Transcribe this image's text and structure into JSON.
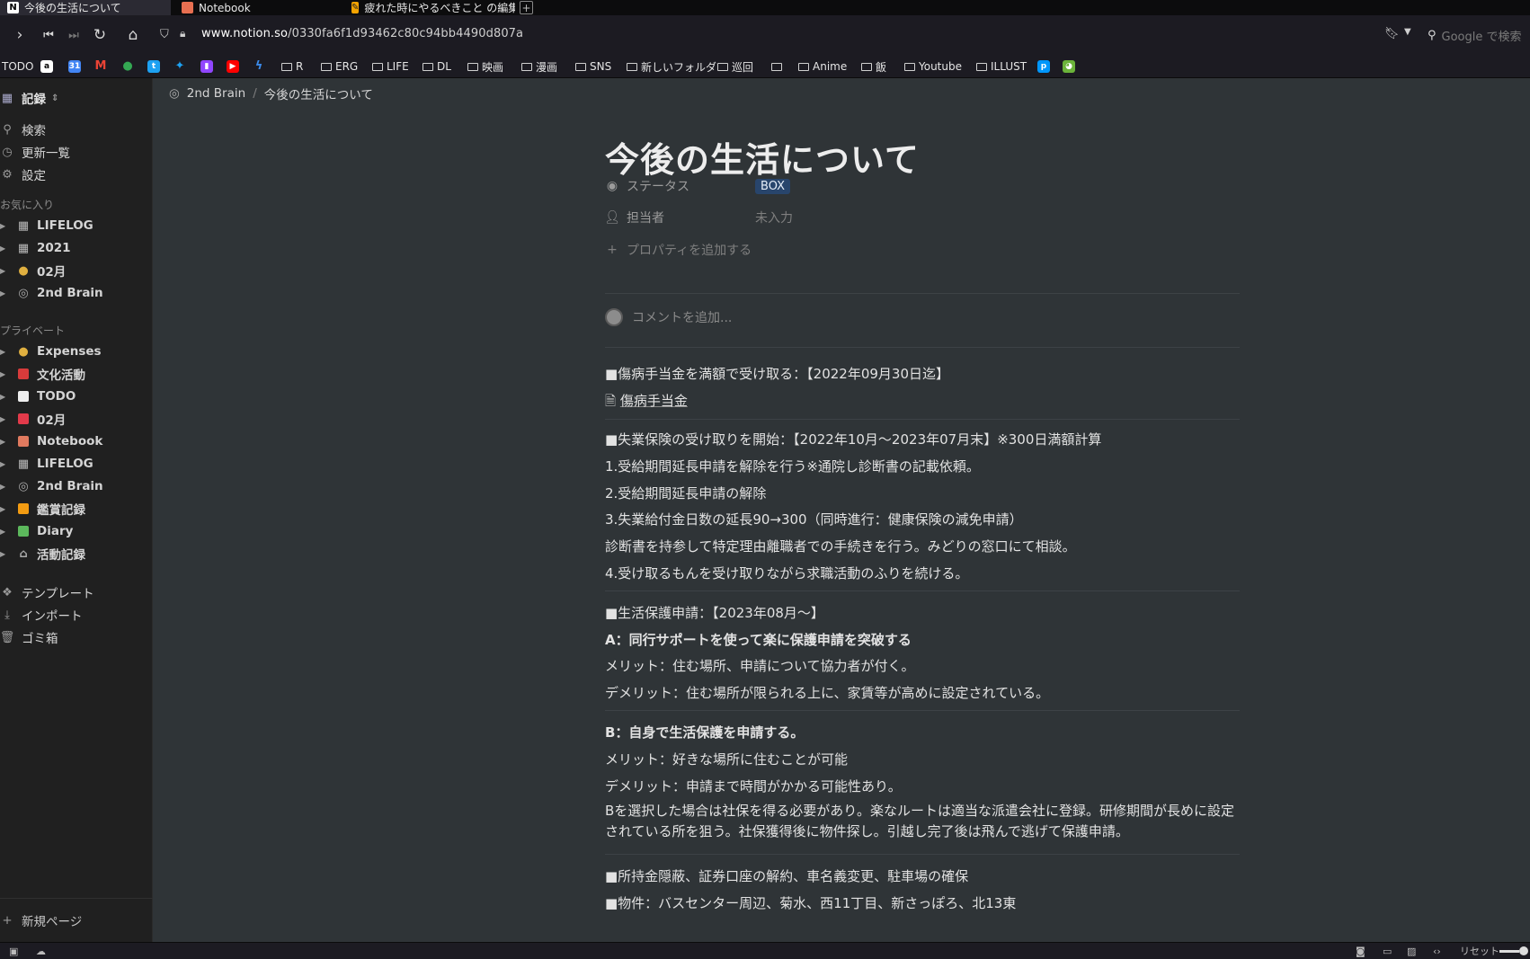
{
  "browser": {
    "tabs": [
      {
        "label": "今後の生活について",
        "icon": "N",
        "active": true
      },
      {
        "label": "Notebook",
        "icon": "notebook",
        "active": false
      },
      {
        "label": "疲れた時にやるべきこと の編集",
        "icon": "edit",
        "active": false
      }
    ],
    "url_host": "www.notion.so",
    "url_path": "/0330fa6f1d93462c80c94bb4490d807a",
    "search_placeholder": "Google で検索",
    "bookmarks": [
      {
        "label": "TODO",
        "type": "text"
      },
      {
        "label": "a",
        "type": "icon",
        "color": "#ffffff"
      },
      {
        "label": "31",
        "type": "icon",
        "color": "#4285f4"
      },
      {
        "label": "M",
        "type": "icon",
        "color": "#ea4335"
      },
      {
        "label": "maps",
        "type": "icon",
        "color": "#34a853"
      },
      {
        "label": "twitter-a",
        "type": "icon",
        "color": "#1da1f2"
      },
      {
        "label": "twitter-b",
        "type": "icon",
        "color": "#1da1f2"
      },
      {
        "label": "twitch",
        "type": "icon",
        "color": "#9146ff"
      },
      {
        "label": "youtube",
        "type": "icon",
        "color": "#ff0000"
      },
      {
        "label": "feather",
        "type": "icon",
        "color": "#3b8beb"
      },
      {
        "label": "R",
        "type": "folder"
      },
      {
        "label": "ERG",
        "type": "folder"
      },
      {
        "label": "LIFE",
        "type": "folder"
      },
      {
        "label": "DL",
        "type": "folder"
      },
      {
        "label": "映画",
        "type": "folder"
      },
      {
        "label": "漫画",
        "type": "folder"
      },
      {
        "label": "SNS",
        "type": "folder"
      },
      {
        "label": "新しいフォルダ",
        "type": "folder"
      },
      {
        "label": "巡回",
        "type": "folder"
      },
      {
        "label": "",
        "type": "folder"
      },
      {
        "label": "Anime",
        "type": "folder"
      },
      {
        "label": "飯",
        "type": "folder"
      },
      {
        "label": "Youtube",
        "type": "folder"
      },
      {
        "label": "ILLUST",
        "type": "folder"
      }
    ],
    "status_reset": "リセット"
  },
  "sidebar": {
    "workspace": "記録",
    "actions": [
      {
        "label": "検索",
        "icon": "search-icon"
      },
      {
        "label": "更新一覧",
        "icon": "clock-icon"
      },
      {
        "label": "設定",
        "icon": "gear-icon"
      }
    ],
    "favorites_title": "お気に入り",
    "favorites": [
      {
        "label": "LIFELOG",
        "icon": "calendar"
      },
      {
        "label": "2021",
        "icon": "calendar"
      },
      {
        "label": "02月",
        "icon": "money-bag"
      },
      {
        "label": "2nd Brain",
        "icon": "brain"
      }
    ],
    "private_title": "プライベート",
    "private": [
      {
        "label": "Expenses",
        "icon": "money-bag"
      },
      {
        "label": "文化活動",
        "icon": "book-red"
      },
      {
        "label": "TODO",
        "icon": "square-white"
      },
      {
        "label": "02月",
        "icon": "square-red"
      },
      {
        "label": "Notebook",
        "icon": "notebook"
      },
      {
        "label": "LIFELOG",
        "icon": "calendar"
      },
      {
        "label": "2nd Brain",
        "icon": "brain"
      },
      {
        "label": "鑑賞記録",
        "icon": "square-orange"
      },
      {
        "label": "Diary",
        "icon": "square-green"
      },
      {
        "label": "活動記録",
        "icon": "home"
      }
    ],
    "bottom": [
      {
        "label": "テンプレート",
        "icon": "template-icon"
      },
      {
        "label": "インポート",
        "icon": "import-icon"
      },
      {
        "label": "ゴミ箱",
        "icon": "trash-icon"
      }
    ],
    "new_page": "新規ページ"
  },
  "breadcrumb": {
    "parent": "2nd Brain",
    "current": "今後の生活について"
  },
  "page": {
    "title": "今後の生活について",
    "properties": [
      {
        "name": "ステータス",
        "value": "BOX",
        "type": "badge"
      },
      {
        "name": "担当者",
        "value": "未入力",
        "type": "empty"
      }
    ],
    "add_property": "プロパティを追加する",
    "comment_placeholder": "コメントを追加...",
    "blocks": [
      {
        "text": "■傷病手当金を満額で受け取る：【2022年09月30日迄】",
        "style": "normal"
      },
      {
        "text": "傷病手当金",
        "style": "link"
      },
      {
        "text": "■失業保険の受け取りを開始：【2022年10月～2023年07月末】※300日満額計算",
        "style": "normal"
      },
      {
        "text": "1.受給期間延長申請を解除を行う※通院し診断書の記載依頼。",
        "style": "normal"
      },
      {
        "text": "2.受給期間延長申請の解除",
        "style": "normal"
      },
      {
        "text": "3.失業給付金日数の延長90→300（同時進行：健康保険の減免申請）",
        "style": "normal"
      },
      {
        "text": "診断書を持参して特定理由離職者での手続きを行う。みどりの窓口にて相談。",
        "style": "normal"
      },
      {
        "text": "4.受け取るもんを受け取りながら求職活動のふりを続ける。",
        "style": "normal"
      },
      {
        "text": "■生活保護申請：【2023年08月～】",
        "style": "normal"
      },
      {
        "text": "A：同行サポートを使って楽に保護申請を突破する",
        "style": "bold"
      },
      {
        "text": "メリット：住む場所、申請について協力者が付く。",
        "style": "normal"
      },
      {
        "text": "デメリット：住む場所が限られる上に、家賃等が高めに設定されている。",
        "style": "normal"
      },
      {
        "text": "B：自身で生活保護を申請する。",
        "style": "bold"
      },
      {
        "text": "メリット：好きな場所に住むことが可能",
        "style": "normal"
      },
      {
        "text": "デメリット：申請まで時間がかかる可能性あり。",
        "style": "normal"
      },
      {
        "text": "Bを選択した場合は社保を得る必要があり。楽なルートは適当な派遣会社に登録。研修期間が長めに設定されている所を狙う。社保獲得後に物件探し。引越し完了後は飛んで逃げて保護申請。",
        "style": "wrap"
      },
      {
        "text": "■所持金隠蔽、証券口座の解約、車名義変更、駐車場の確保",
        "style": "normal"
      },
      {
        "text": "■物件：バスセンター周辺、菊水、西11丁目、新さっぽろ、北13東",
        "style": "normal"
      }
    ]
  }
}
